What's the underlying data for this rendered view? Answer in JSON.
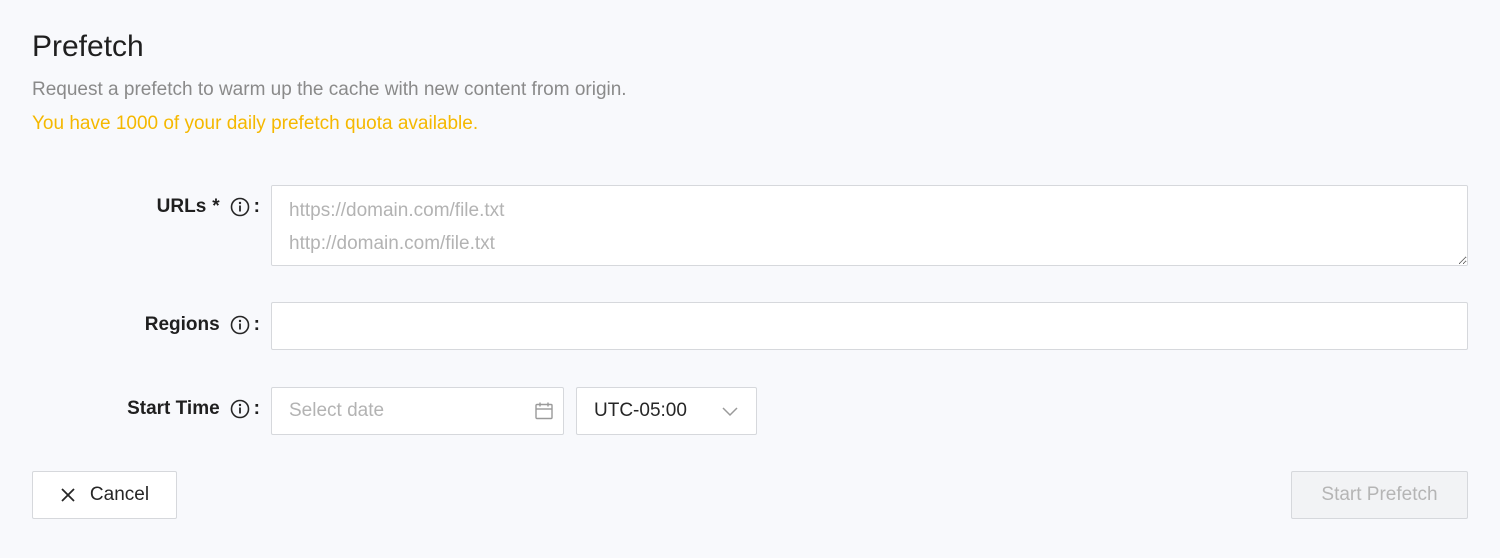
{
  "header": {
    "title": "Prefetch",
    "description": "Request a prefetch to warm up the cache with new content from origin.",
    "quota_notice": "You have 1000 of your daily prefetch quota available."
  },
  "form": {
    "urls": {
      "label": "URLs",
      "required_marker": "*",
      "placeholder": "https://domain.com/file.txt\nhttp://domain.com/file.txt",
      "value": ""
    },
    "regions": {
      "label": "Regions",
      "value": ""
    },
    "start_time": {
      "label": "Start Time",
      "date_placeholder": "Select date",
      "timezone": "UTC-05:00"
    },
    "colon": ":"
  },
  "actions": {
    "cancel_label": "Cancel",
    "start_label": "Start Prefetch"
  },
  "icons": {
    "info": "info-icon",
    "calendar": "calendar-icon",
    "chevron": "chevron-down-icon",
    "close": "close-icon"
  },
  "colors": {
    "quota": "#f5b800",
    "background": "#f8f9fc",
    "border": "#d6d8dc",
    "disabled_text": "#b5b5b5"
  }
}
